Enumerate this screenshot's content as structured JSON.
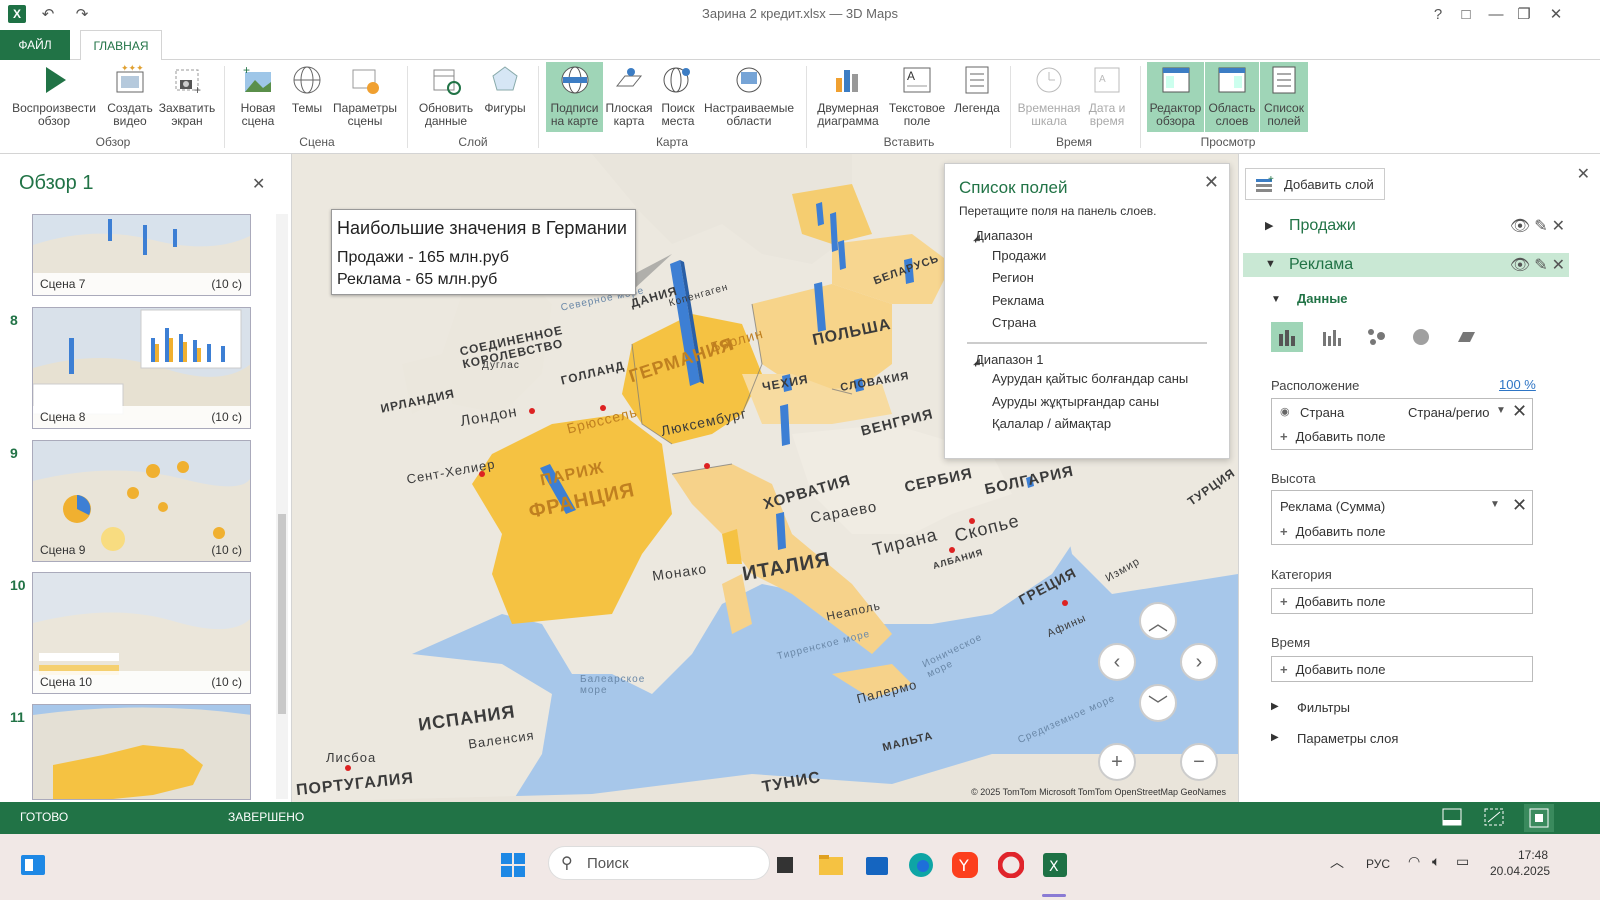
{
  "window": {
    "title": "Зарина 2 кредит.xlsx — 3D Maps",
    "controls": [
      "?",
      "□",
      "—",
      "❐",
      "✕"
    ]
  },
  "ribbon": {
    "tabs": {
      "file": "ФАЙЛ",
      "home": "ГЛАВНАЯ"
    },
    "buttons": {
      "play_tour": "Воспроизвести обзор",
      "create_video": "Создать видео",
      "capture_screen": "Захватить экран",
      "new_scene": "Новая сцена",
      "themes": "Темы",
      "scene_options": "Параметры сцены",
      "refresh_data": "Обновить данные",
      "shapes": "Фигуры",
      "map_labels": "Подписи на карте",
      "flat_map": "Плоская карта",
      "find_location": "Поиск места",
      "custom_regions": "Настраиваемые области",
      "chart_2d": "Двумерная диаграмма",
      "text_box": "Текстовое поле",
      "legend": "Легенда",
      "timeline": "Временная шкала",
      "date_time": "Дата и время",
      "tour_editor": "Редактор обзора",
      "layer_pane": "Область слоев",
      "field_list": "Список полей"
    },
    "groups": {
      "tour": "Обзор",
      "scene": "Сцена",
      "layer": "Слой",
      "map": "Карта",
      "insert": "Вставить",
      "time": "Время",
      "view": "Просмотр"
    }
  },
  "tour_panel": {
    "title": "Обзор 1",
    "scenes": [
      {
        "num": "",
        "name": "Сцена 7",
        "duration": "(10 с)"
      },
      {
        "num": "8",
        "name": "Сцена 8",
        "duration": "(10 с)"
      },
      {
        "num": "9",
        "name": "Сцена 9",
        "duration": "(10 с)"
      },
      {
        "num": "10",
        "name": "Сцена 10",
        "duration": "(10 с)"
      },
      {
        "num": "11",
        "name": "",
        "duration": ""
      }
    ]
  },
  "map": {
    "callout": {
      "title": "Наибольшие значения в Германии",
      "line1": "Продажи - 165 млн.руб",
      "line2": "Реклама  - 65 млн.руб"
    },
    "labels": {
      "germany": "ГЕРМАНИЯ",
      "france": "ФРАНЦИЯ",
      "poland": "ПОЛЬША",
      "italy": "ИТАЛИЯ",
      "spain": "ИСПАНИЯ",
      "portugal": "ПОРТУГАЛИЯ",
      "uk": "СОЕДИНЕННОЕ КОРОЛЕВСТВО",
      "ireland": "ИРЛАНДИЯ",
      "london": "Лондон",
      "paris": "ПАРИЖ",
      "hungary": "ВЕНГРИЯ",
      "croatia": "ХОРВАТИЯ",
      "serbia": "СЕРБИЯ",
      "bulgaria": "БОЛГАРИЯ",
      "greece": "ГРЕЦИЯ",
      "turkey": "ТУРЦИЯ",
      "czech": "ЧЕХИЯ",
      "slovakia": "СЛОВАКИЯ",
      "holland": "ГОЛЛАНД",
      "denmark": "ДАНИЯ",
      "belarus": "БЕЛАРУСЬ",
      "monaco": "Монако",
      "sarajevo": "Сараево",
      "tirana": "Тирана",
      "skopje": "Скопье",
      "naples": "Неаполь",
      "palermo": "Палермо",
      "tunisia": "ТУНИС",
      "lisbon": "Лисбоа",
      "valencia": "Валенсия",
      "malta": "МАЛЬТА",
      "saint_helier": "Сент-Хелиер",
      "berlin": "Берлин",
      "brussels": "Брюссель",
      "luxembourg": "Люксембург",
      "douglas": "Дуглас",
      "balearic": "Балеарское море",
      "tyrrhenian": "Тирренское море",
      "ionian": "Ионическое море",
      "mediterranean": "Средиземное море",
      "athens": "Афины",
      "izmir": "Измир",
      "north_sea": "Северное море",
      "copenhagen": "Копенгаген",
      "albania": "АЛБАНИЯ"
    },
    "copyright": "© 2025 TomTom  Microsoft  TomTom  OpenStreetMap  GeoNames"
  },
  "field_list": {
    "title": "Список полей",
    "subtitle": "Перетащите поля на панель слоев.",
    "range1": {
      "name": "Диапазон",
      "items": [
        "Продажи",
        "Регион",
        "Реклама",
        "Страна"
      ]
    },
    "range2": {
      "name": "Диапазон 1",
      "items": [
        "Аурудан қайтыс болғандар саны",
        "Ауруды жұқтырғандар саны",
        "Қалалар / аймақтар"
      ]
    }
  },
  "layer_pane": {
    "add_layer": "Добавить слой",
    "layers": [
      {
        "name": "Продажи",
        "expanded": false
      },
      {
        "name": "Реклама",
        "expanded": true
      }
    ],
    "data_label": "Данные",
    "location_label": "Расположение",
    "location_percent": "100 %",
    "location_field": "Страна",
    "location_type": "Страна/регио",
    "add_field": "Добавить поле",
    "height_label": "Высота",
    "height_field": "Реклама (Сумма)",
    "category_label": "Категория",
    "time_label": "Время",
    "filters_label": "Фильтры",
    "layer_options_label": "Параметры слоя"
  },
  "status": {
    "ready": "ГОТОВО",
    "done": "ЗАВЕРШЕНО"
  },
  "taskbar": {
    "search_placeholder": "Поиск",
    "language": "РУС",
    "time": "17:48",
    "date": "20.04.2025"
  },
  "colors": {
    "accent": "#217346",
    "highlight": "#9fd5b7",
    "country_fill": "#f5c242",
    "bar": "#3d7fd4",
    "sea": "#a7c7ea"
  }
}
